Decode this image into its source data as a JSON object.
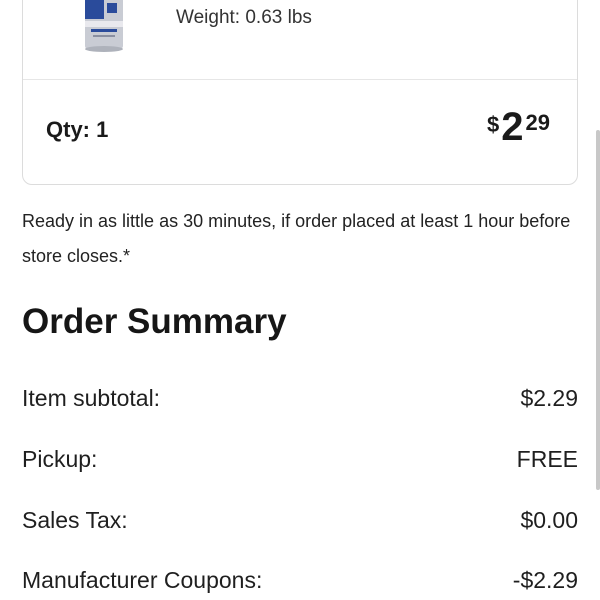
{
  "product": {
    "weight_text": "Weight: 0.63 lbs",
    "quantity_text": "Qty: 1",
    "price": {
      "currency": "$",
      "dollars": "2",
      "cents": "29"
    }
  },
  "pickup_notice": "Ready in as little as 30 minutes, if order placed at least 1 hour before store closes.*",
  "order_summary": {
    "title": "Order Summary",
    "rows": [
      {
        "label": "Item subtotal:",
        "value": "$2.29"
      },
      {
        "label": "Pickup:",
        "value": "FREE"
      },
      {
        "label": "Sales Tax:",
        "value": "$0.00"
      },
      {
        "label": "Manufacturer Coupons:",
        "value": "-$2.29"
      }
    ]
  },
  "colors": {
    "can_blue": "#2a4b9b",
    "can_silver": "#c9ccd4",
    "can_red": "#d6213b"
  }
}
